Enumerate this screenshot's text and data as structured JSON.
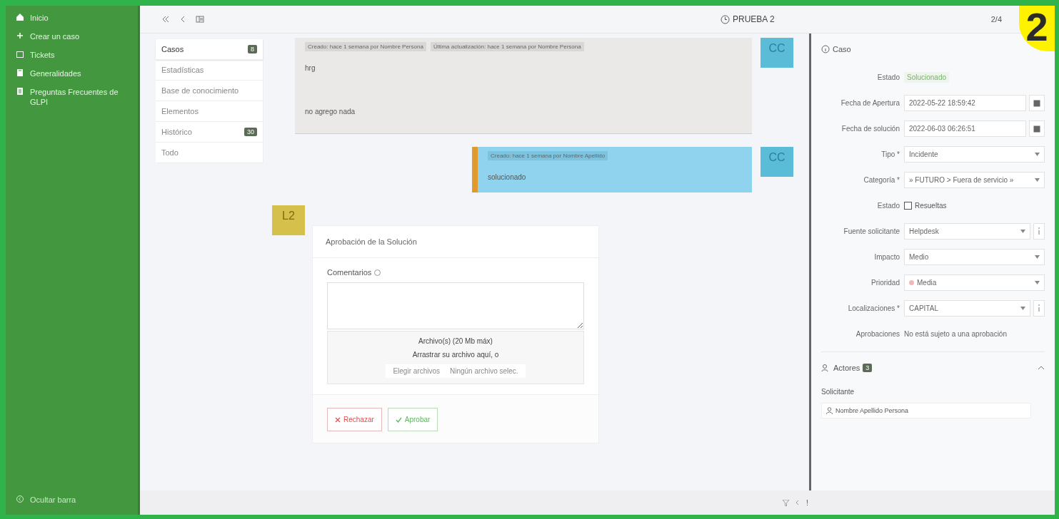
{
  "sidebar": {
    "items": [
      {
        "label": "Inicio"
      },
      {
        "label": "Crear un caso"
      },
      {
        "label": "Tickets"
      },
      {
        "label": "Generalidades"
      },
      {
        "label": "Preguntas Frecuentes de GLPI"
      }
    ],
    "footer": "Ocultar barra"
  },
  "topbar": {
    "title": "PRUEBA 2",
    "counter": "2/4"
  },
  "tabs": [
    {
      "label": "Casos",
      "badge": "8",
      "selected": true
    },
    {
      "label": "Estadísticas",
      "selected": false
    },
    {
      "label": "Base de conocimiento",
      "selected": false
    },
    {
      "label": "Elementos",
      "selected": false
    },
    {
      "label": "Histórico",
      "badge": "30",
      "selected": false
    },
    {
      "label": "Todo",
      "selected": false
    }
  ],
  "timeline": [
    {
      "kind": "followup",
      "avatar": "CC",
      "meta": [
        "Creado: hace 1 semana por Nombre Persona",
        "Última actualización: hace 1 semana por Nombre Persona"
      ],
      "lines": [
        "hrg",
        "no agrego nada"
      ]
    },
    {
      "kind": "solution",
      "avatar": "CC",
      "meta": [
        "Creado: hace 1 semana por Nombre Apellido"
      ],
      "lines": [
        "solucionado"
      ]
    }
  ],
  "approval": {
    "avatar": "L2",
    "title": "Aprobación de la Solución",
    "comment_label": "Comentarios",
    "upload_title": "Archivo(s) (20 Mb máx)",
    "upload_hint": "Arrastrar su archivo aquí, o",
    "choose_button": "Elegir archivos",
    "no_file": "Ningún archivo selec.",
    "buttons": [
      {
        "kind": "reject",
        "label": "Rechazar"
      },
      {
        "kind": "approve",
        "label": "Aprobar"
      }
    ]
  },
  "case_panel": {
    "title": "Caso",
    "fields": [
      {
        "kind": "status",
        "label": "Estado",
        "value": "Solucionado"
      },
      {
        "kind": "date",
        "label": "Fecha de Apertura",
        "value": "2022-05-22 18:59:42"
      },
      {
        "kind": "date",
        "label": "Fecha de solución",
        "value": "2022-06-03 06:26:51"
      },
      {
        "kind": "select",
        "label": "Tipo *",
        "value": "Incidente"
      },
      {
        "kind": "select",
        "label": "Categoría *",
        "value": "» FUTURO > Fuera de servicio »"
      },
      {
        "kind": "checkbox",
        "label": "Estado",
        "value": "Resueltas",
        "checked": false
      },
      {
        "kind": "select_info",
        "label": "Fuente solicitante",
        "value": "Helpdesk"
      },
      {
        "kind": "select",
        "label": "Impacto",
        "value": "Medio"
      },
      {
        "kind": "priority",
        "label": "Prioridad",
        "value": "Media",
        "color": "#f4b6b6"
      },
      {
        "kind": "select_info",
        "label": "Localizaciones *",
        "value": "CAPITAL"
      },
      {
        "kind": "text",
        "label": "Aprobaciones",
        "value": "No está sujeto a una aprobación"
      }
    ]
  },
  "actors": {
    "title": "Actores",
    "badge": "3",
    "role": "Solicitante",
    "person": "Nombre Apellido Persona"
  },
  "bottom_icons": [
    "!"
  ],
  "step_marker": "2"
}
